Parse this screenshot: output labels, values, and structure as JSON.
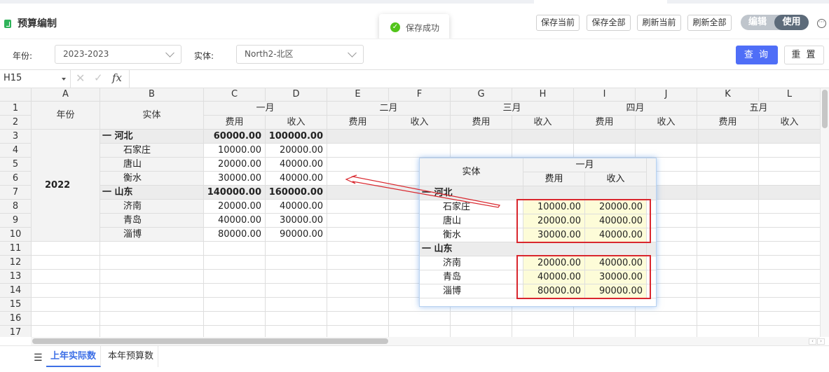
{
  "app": {
    "title": "预算编制",
    "toast": "保存成功"
  },
  "toolbar": {
    "save_current": "保存当前",
    "save_all": "保存全部",
    "refresh_current": "刷新当前",
    "refresh_all": "刷新全部",
    "mode_edit": "编辑",
    "mode_use": "使用"
  },
  "filters": {
    "year_label": "年份:",
    "year_value": "2023-2023",
    "entity_label": "实体:",
    "entity_value": "North2-北区",
    "query_button": "查 询",
    "reset_button": "重 置"
  },
  "formula_bar": {
    "cell_ref": "H15",
    "fx": "fx"
  },
  "sheet": {
    "columns": [
      "A",
      "B",
      "C",
      "D",
      "E",
      "F",
      "G",
      "H",
      "I",
      "J",
      "K",
      "L"
    ],
    "rows": [
      "1",
      "2",
      "3",
      "4",
      "5",
      "6",
      "7",
      "8",
      "9",
      "10",
      "11",
      "12",
      "13",
      "14",
      "15",
      "16",
      "17"
    ],
    "header_year": "年份",
    "header_entity": "实体",
    "months": [
      "一月",
      "二月",
      "三月",
      "四月",
      "五月"
    ],
    "sub_cost": "费用",
    "sub_income": "收入",
    "year_value": "2022",
    "data": [
      {
        "label": "一 河北",
        "cost": "60000.00",
        "income": "100000.00",
        "group": true
      },
      {
        "label": "石家庄",
        "cost": "10000.00",
        "income": "20000.00",
        "group": false
      },
      {
        "label": "唐山",
        "cost": "20000.00",
        "income": "40000.00",
        "group": false
      },
      {
        "label": "衡水",
        "cost": "30000.00",
        "income": "40000.00",
        "group": false
      },
      {
        "label": "一 山东",
        "cost": "140000.00",
        "income": "160000.00",
        "group": true
      },
      {
        "label": "济南",
        "cost": "20000.00",
        "income": "40000.00",
        "group": false
      },
      {
        "label": "青岛",
        "cost": "40000.00",
        "income": "30000.00",
        "group": false
      },
      {
        "label": "淄博",
        "cost": "80000.00",
        "income": "90000.00",
        "group": false
      }
    ]
  },
  "popup": {
    "header_entity": "实体",
    "month": "一月",
    "sub_cost": "费用",
    "sub_income": "收入",
    "rows": [
      {
        "label": "一 河北",
        "cost": "",
        "income": "",
        "group": true
      },
      {
        "label": "石家庄",
        "cost": "10000.00",
        "income": "20000.00",
        "group": false
      },
      {
        "label": "唐山",
        "cost": "20000.00",
        "income": "40000.00",
        "group": false
      },
      {
        "label": "衡水",
        "cost": "30000.00",
        "income": "40000.00",
        "group": false
      },
      {
        "label": "一 山东",
        "cost": "",
        "income": "",
        "group": true
      },
      {
        "label": "济南",
        "cost": "20000.00",
        "income": "40000.00",
        "group": false
      },
      {
        "label": "青岛",
        "cost": "40000.00",
        "income": "30000.00",
        "group": false
      },
      {
        "label": "淄博",
        "cost": "80000.00",
        "income": "90000.00",
        "group": false
      }
    ]
  },
  "tabs": {
    "menu_icon": "☰",
    "items": [
      "上年实际数",
      "本年预算数"
    ]
  },
  "colors": {
    "accent": "#4f6ef7",
    "annotation": "#d9272e",
    "highlight": "#fdfcd8"
  }
}
